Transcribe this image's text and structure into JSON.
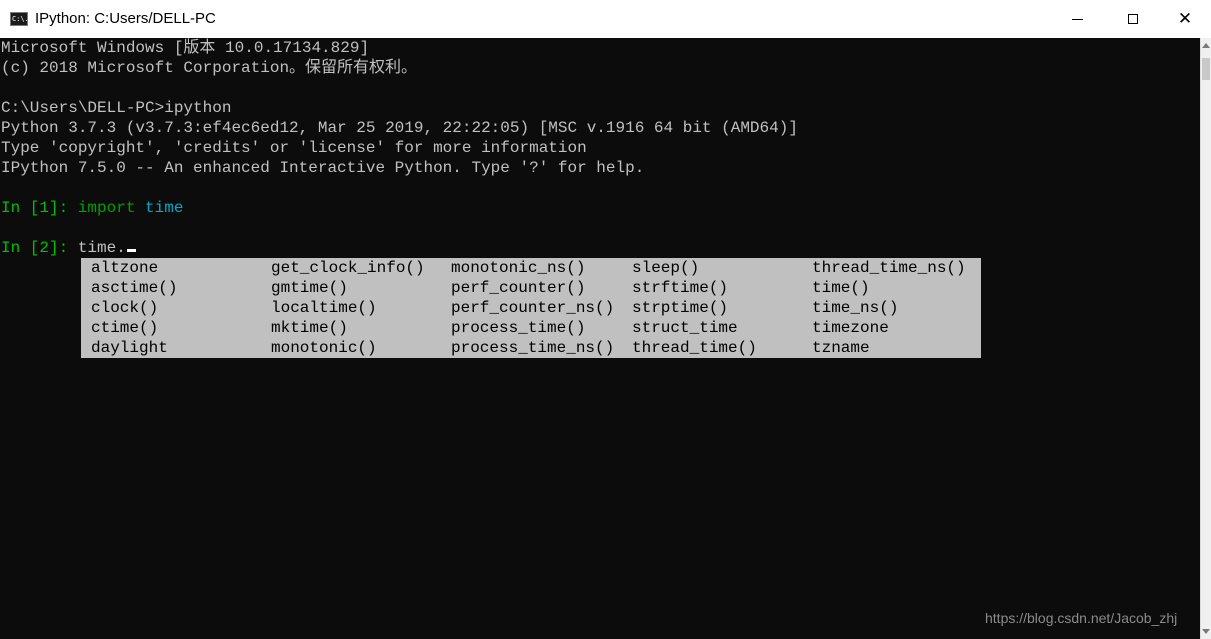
{
  "window": {
    "title": "IPython: C:Users/DELL-PC",
    "app_icon": "console-icon",
    "app_icon_text": "C:\\.",
    "controls": [
      "minimize-icon",
      "maximize-icon",
      "close-icon"
    ],
    "close_glyph": "✕"
  },
  "console": {
    "lines": [
      "Microsoft Windows [版本 10.0.17134.829]",
      "(c) 2018 Microsoft Corporation。保留所有权利。",
      "",
      "C:\\Users\\DELL-PC>ipython",
      "Python 3.7.3 (v3.7.3:ef4ec6ed12, Mar 25 2019, 22:22:05) [MSC v.1916 64 bit (AMD64)]",
      "Type 'copyright', 'credits' or 'license' for more information",
      "IPython 7.5.0 -- An enhanced Interactive Python. Type '?' for help."
    ],
    "prompt1": {
      "label": "In [1]: ",
      "keyword": "import",
      "module": "time"
    },
    "prompt2": {
      "label": "In [2]: ",
      "input": "time."
    },
    "completions": [
      [
        "altzone",
        "get_clock_info()",
        "monotonic_ns()",
        "sleep()",
        "thread_time_ns()"
      ],
      [
        "asctime()",
        "gmtime()",
        "perf_counter()",
        "strftime()",
        "time()"
      ],
      [
        "clock()",
        "localtime()",
        "perf_counter_ns()",
        "strptime()",
        "time_ns()"
      ],
      [
        "ctime()",
        "mktime()",
        "process_time()",
        "struct_time",
        "timezone"
      ],
      [
        "daylight",
        "monotonic()",
        "process_time_ns()",
        "thread_time()",
        "tzname"
      ]
    ]
  },
  "watermark": "https://blog.csdn.net/Jacob_zhj",
  "colors": {
    "console_bg": "#0c0c0c",
    "console_text": "#c0c0c0",
    "prompt_green": "#00c000",
    "keyword_green": "#00a000",
    "module_cyan": "#00a8c8",
    "popup_bg": "#c0c0c0"
  }
}
